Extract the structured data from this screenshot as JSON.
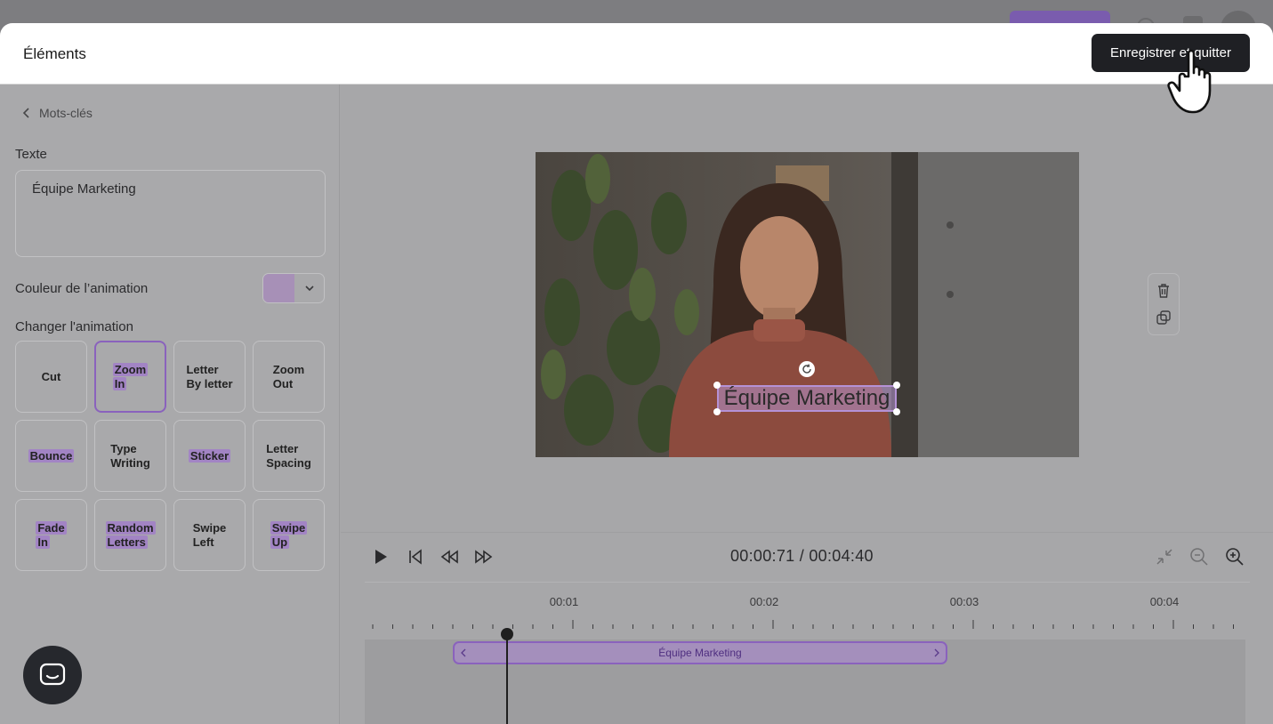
{
  "modal": {
    "title": "Éléments",
    "save_button": "Enregistrer et quitter"
  },
  "panel": {
    "back_label": "Mots-clés",
    "text_label": "Texte",
    "text_value": "Équipe Marketing",
    "color_label": "Couleur de l’animation",
    "color_value": "#a790b7",
    "animation_label": "Changer l'animation",
    "animations": [
      {
        "line1": "Cut",
        "line2": "",
        "selected": false,
        "highlight": false
      },
      {
        "line1": "Zoom",
        "line2": "In",
        "selected": true,
        "highlight": true
      },
      {
        "line1": "Letter",
        "line2": "By letter",
        "selected": false,
        "highlight": false
      },
      {
        "line1": "Zoom",
        "line2": "Out",
        "selected": false,
        "highlight": false
      },
      {
        "line1": "Bounce",
        "line2": "",
        "selected": false,
        "highlight": true
      },
      {
        "line1": "Type",
        "line2": "Writing",
        "selected": false,
        "highlight": false
      },
      {
        "line1": "Sticker",
        "line2": "",
        "selected": false,
        "highlight": true
      },
      {
        "line1": "Letter",
        "line2": "Spacing",
        "selected": false,
        "highlight": false
      },
      {
        "line1": "Fade",
        "line2": "In",
        "selected": false,
        "highlight": true
      },
      {
        "line1": "Random",
        "line2": "Letters",
        "selected": false,
        "highlight": true
      },
      {
        "line1": "Swipe",
        "line2": "Left",
        "selected": false,
        "highlight": false
      },
      {
        "line1": "Swipe",
        "line2": "Up",
        "selected": false,
        "highlight": true
      }
    ]
  },
  "canvas": {
    "overlay_text": "Équipe Marketing"
  },
  "timeline": {
    "time_display": "00:00:71 / 00:04:40",
    "ticks": [
      "00:01",
      "00:02",
      "00:03",
      "00:04"
    ],
    "clip_label": "Équipe Marketing"
  },
  "icons": {
    "back": "chevron-left-icon",
    "color_dropdown": "chevron-down-icon",
    "delete": "trash-icon",
    "duplicate": "copy-icon",
    "play": "play-icon",
    "skip_start": "skip-back-icon",
    "rewind": "rewind-icon",
    "forward": "fast-forward-icon",
    "fit": "collapse-icon",
    "zoom_out": "zoom-out-icon",
    "zoom_in": "zoom-in-icon",
    "chat": "chat-icon",
    "refresh": "rotate-icon"
  },
  "colors": {
    "accent": "#8a62bd",
    "button_dark": "#1f2024"
  }
}
